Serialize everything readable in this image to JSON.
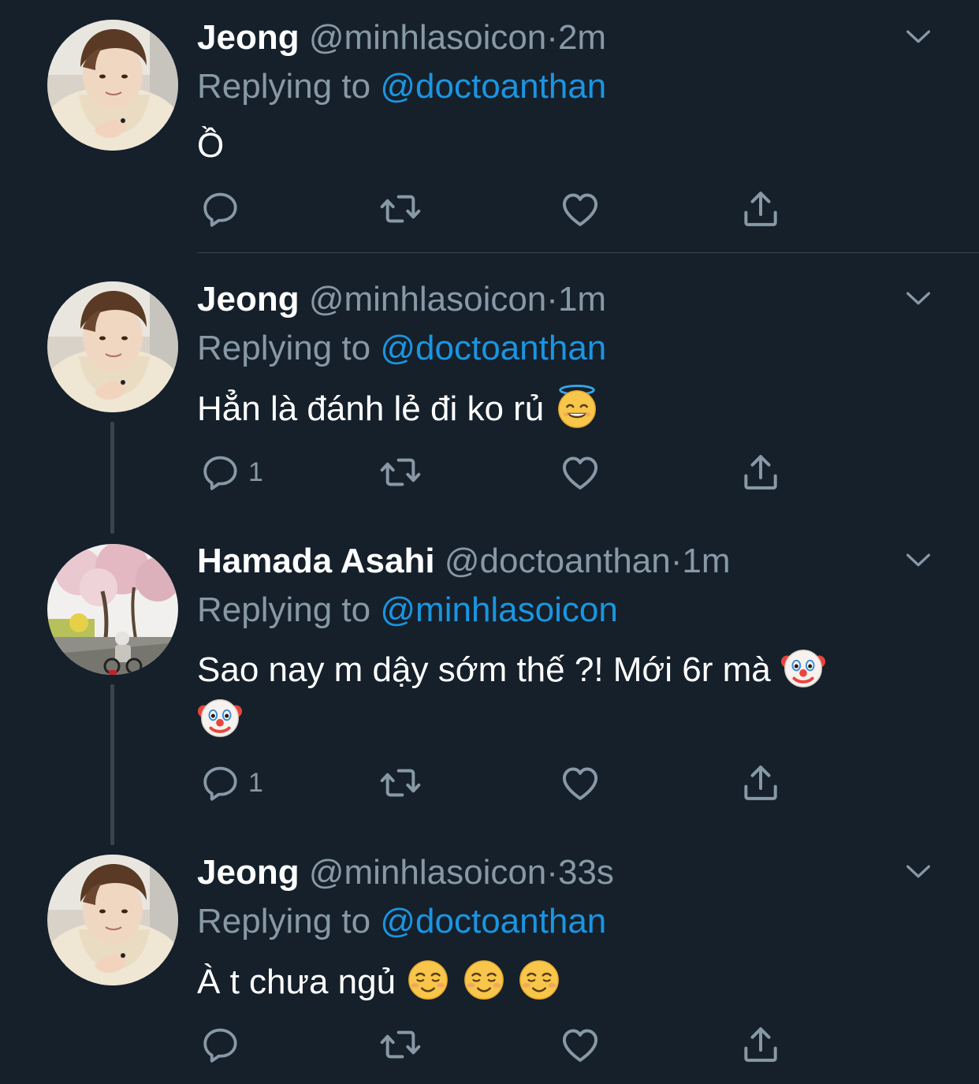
{
  "colors": {
    "background": "#15202b",
    "text_primary": "#ffffff",
    "text_secondary": "#8899a6",
    "link": "#1b95e0",
    "divider": "#38444d"
  },
  "tweets": [
    {
      "name": "Jeong",
      "handle": "@minhlasoicon",
      "separator": "·",
      "time": "2m",
      "reply_prefix": "Replying to",
      "reply_to": "@doctoanthan",
      "text": "Ồ",
      "reply_count": "",
      "avatar": "jeong-avatar"
    },
    {
      "name": "Jeong",
      "handle": "@minhlasoicon",
      "separator": "·",
      "time": "1m",
      "reply_prefix": "Replying to",
      "reply_to": "@doctoanthan",
      "text": "Hẳn là đánh lẻ đi ko rủ",
      "emoji": [
        "halo-smile-emoji"
      ],
      "reply_count": "1",
      "avatar": "jeong-avatar"
    },
    {
      "name": "Hamada Asahi",
      "handle": "@doctoanthan",
      "separator": "·",
      "time": "1m",
      "reply_prefix": "Replying to",
      "reply_to": "@minhlasoicon",
      "text": "Sao nay m dậy sớm thế ?! Mới 6r mà",
      "emoji": [
        "clown-emoji",
        "clown-emoji"
      ],
      "reply_count": "1",
      "avatar": "cherry-blossom-bicycle-avatar"
    },
    {
      "name": "Jeong",
      "handle": "@minhlasoicon",
      "separator": "·",
      "time": "33s",
      "reply_prefix": "Replying to",
      "reply_to": "@doctoanthan",
      "text": "À t chưa ngủ",
      "emoji": [
        "relieved-smile-emoji",
        "relieved-smile-emoji",
        "relieved-smile-emoji"
      ],
      "reply_count": "",
      "avatar": "jeong-avatar"
    }
  ],
  "icons": {
    "reply": "reply-icon",
    "retweet": "retweet-icon",
    "like": "heart-icon",
    "share": "share-icon",
    "menu": "chevron-down-icon"
  }
}
